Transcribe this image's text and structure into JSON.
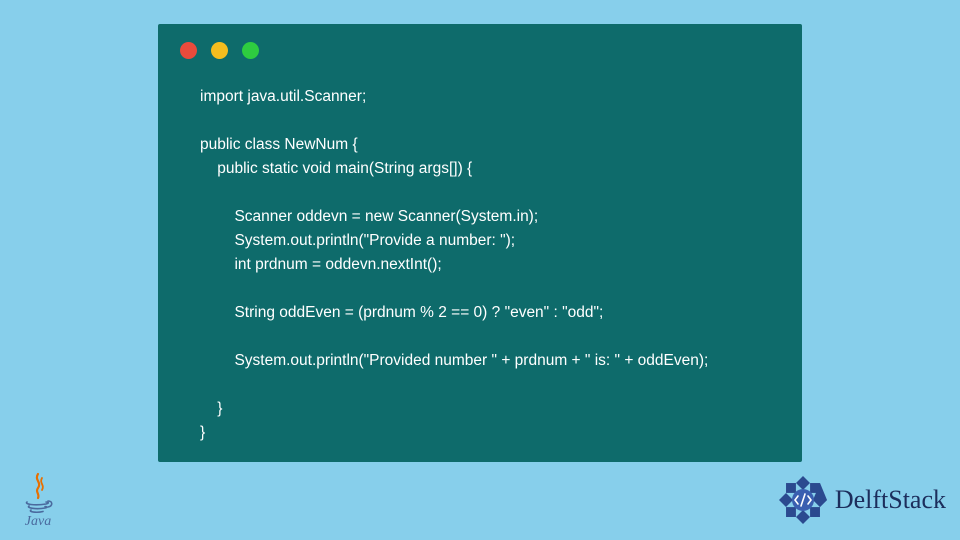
{
  "code": {
    "line1": "import java.util.Scanner;",
    "line2": "",
    "line3": "public class NewNum {",
    "line4": "    public static void main(String args[]) {",
    "line5": "",
    "line6": "        Scanner oddevn = new Scanner(System.in);",
    "line7": "        System.out.println(\"Provide a number: \");",
    "line8": "        int prdnum = oddevn.nextInt();",
    "line9": "",
    "line10": "        String oddEven = (prdnum % 2 == 0) ? \"even\" : \"odd\";",
    "line11": "",
    "line12": "        System.out.println(\"Provided number \" + prdnum + \" is: \" + oddEven);",
    "line13": "",
    "line14": "    }",
    "line15": "}"
  },
  "logos": {
    "java_label": "Java",
    "delftstack_label": "DelftStack"
  },
  "colors": {
    "background": "#87cfeb",
    "window": "#0e6b6b",
    "code_text": "#ffffff",
    "dot_red": "#e94b3c",
    "dot_yellow": "#f5bd1f",
    "dot_green": "#2ecc40",
    "delft_blue": "#1c2e5c"
  }
}
